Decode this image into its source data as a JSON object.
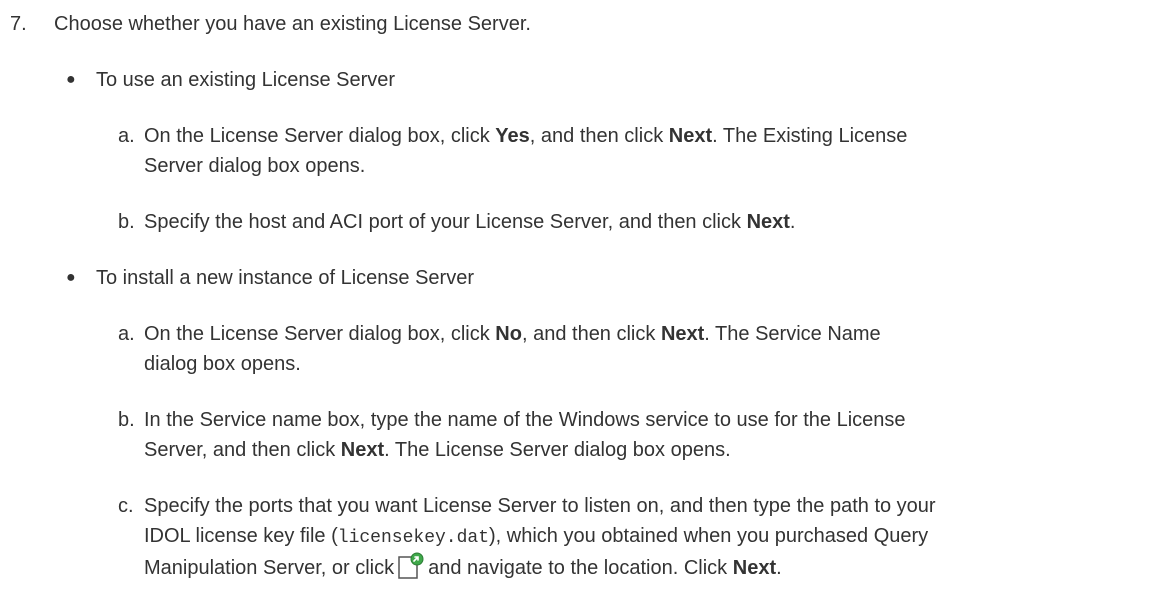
{
  "step": {
    "number": "7.",
    "text": "Choose whether you have an existing License Server."
  },
  "bullets": [
    {
      "text": "To use an existing License Server",
      "steps": [
        {
          "letter": "a.",
          "line1_pre": "On the License Server dialog box, click ",
          "line1_b1": "Yes",
          "line1_mid": ", and then click ",
          "line1_b2": "Next",
          "line1_post": ". The Existing License",
          "line2": "Server dialog box opens."
        },
        {
          "letter": "b.",
          "line1_pre": "Specify the host and ACI port of your License Server, and then click ",
          "line1_b1": "Next",
          "line1_post": "."
        }
      ]
    },
    {
      "text": "To install a new instance of License Server",
      "steps": [
        {
          "letter": "a.",
          "line1_pre": "On the License Server dialog box, click ",
          "line1_b1": "No",
          "line1_mid": ", and then click ",
          "line1_b2": "Next",
          "line1_post": ". The Service Name",
          "line2": "dialog box opens."
        },
        {
          "letter": "b.",
          "line1": "In the Service name box, type the name of the Windows service to use for the License",
          "line2_pre": "Server, and then click ",
          "line2_b1": "Next",
          "line2_post": ". The License Server dialog box opens."
        },
        {
          "letter": "c.",
          "line1": "Specify the ports that you want License Server to listen on, and then type the path to your",
          "line2_pre": "IDOL license key file (",
          "line2_code": "licensekey.dat",
          "line2_post": "), which you obtained when you purchased Query",
          "line3_pre": "Manipulation Server, or click",
          "line3_icon": "browse-file-icon",
          "line3_mid": "and navigate to the location. Click ",
          "line3_b1": "Next",
          "line3_post": "."
        }
      ]
    }
  ]
}
